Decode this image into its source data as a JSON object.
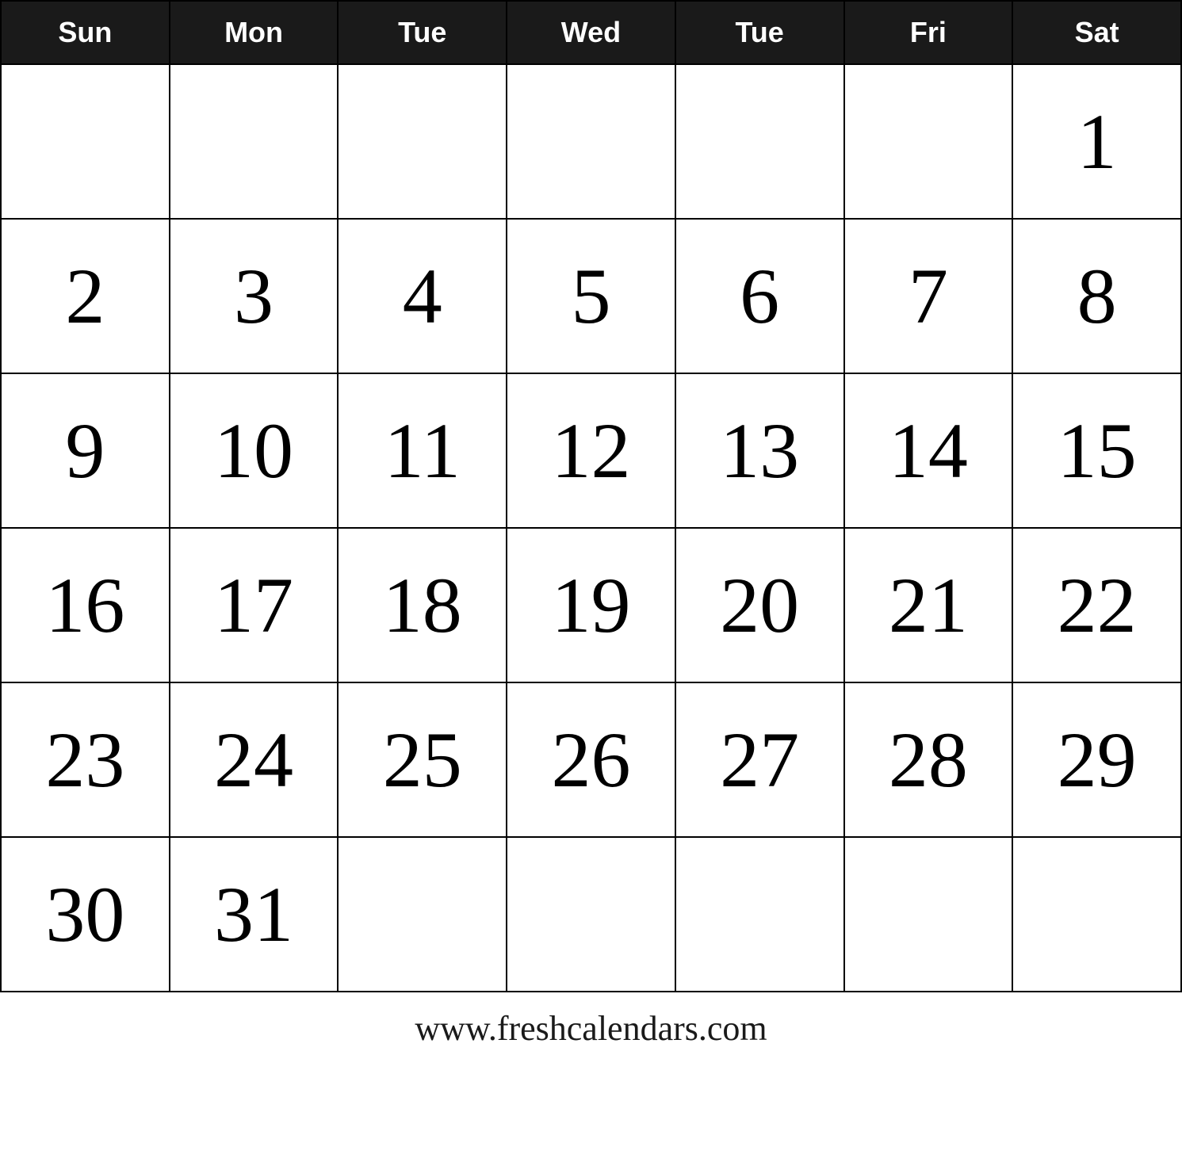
{
  "calendar": {
    "headers": [
      "Sun",
      "Mon",
      "Tue",
      "Wed",
      "Tue",
      "Fri",
      "Sat"
    ],
    "rows": [
      [
        "",
        "",
        "",
        "",
        "",
        "",
        "1"
      ],
      [
        "2",
        "3",
        "4",
        "5",
        "6",
        "7",
        "8"
      ],
      [
        "9",
        "10",
        "11",
        "12",
        "13",
        "14",
        "15"
      ],
      [
        "16",
        "17",
        "18",
        "19",
        "20",
        "21",
        "22"
      ],
      [
        "23",
        "24",
        "25",
        "26",
        "27",
        "28",
        "29"
      ],
      [
        "30",
        "31",
        "",
        "",
        "",
        "",
        ""
      ]
    ]
  },
  "footer": {
    "url": "www.freshcalendars.com"
  }
}
